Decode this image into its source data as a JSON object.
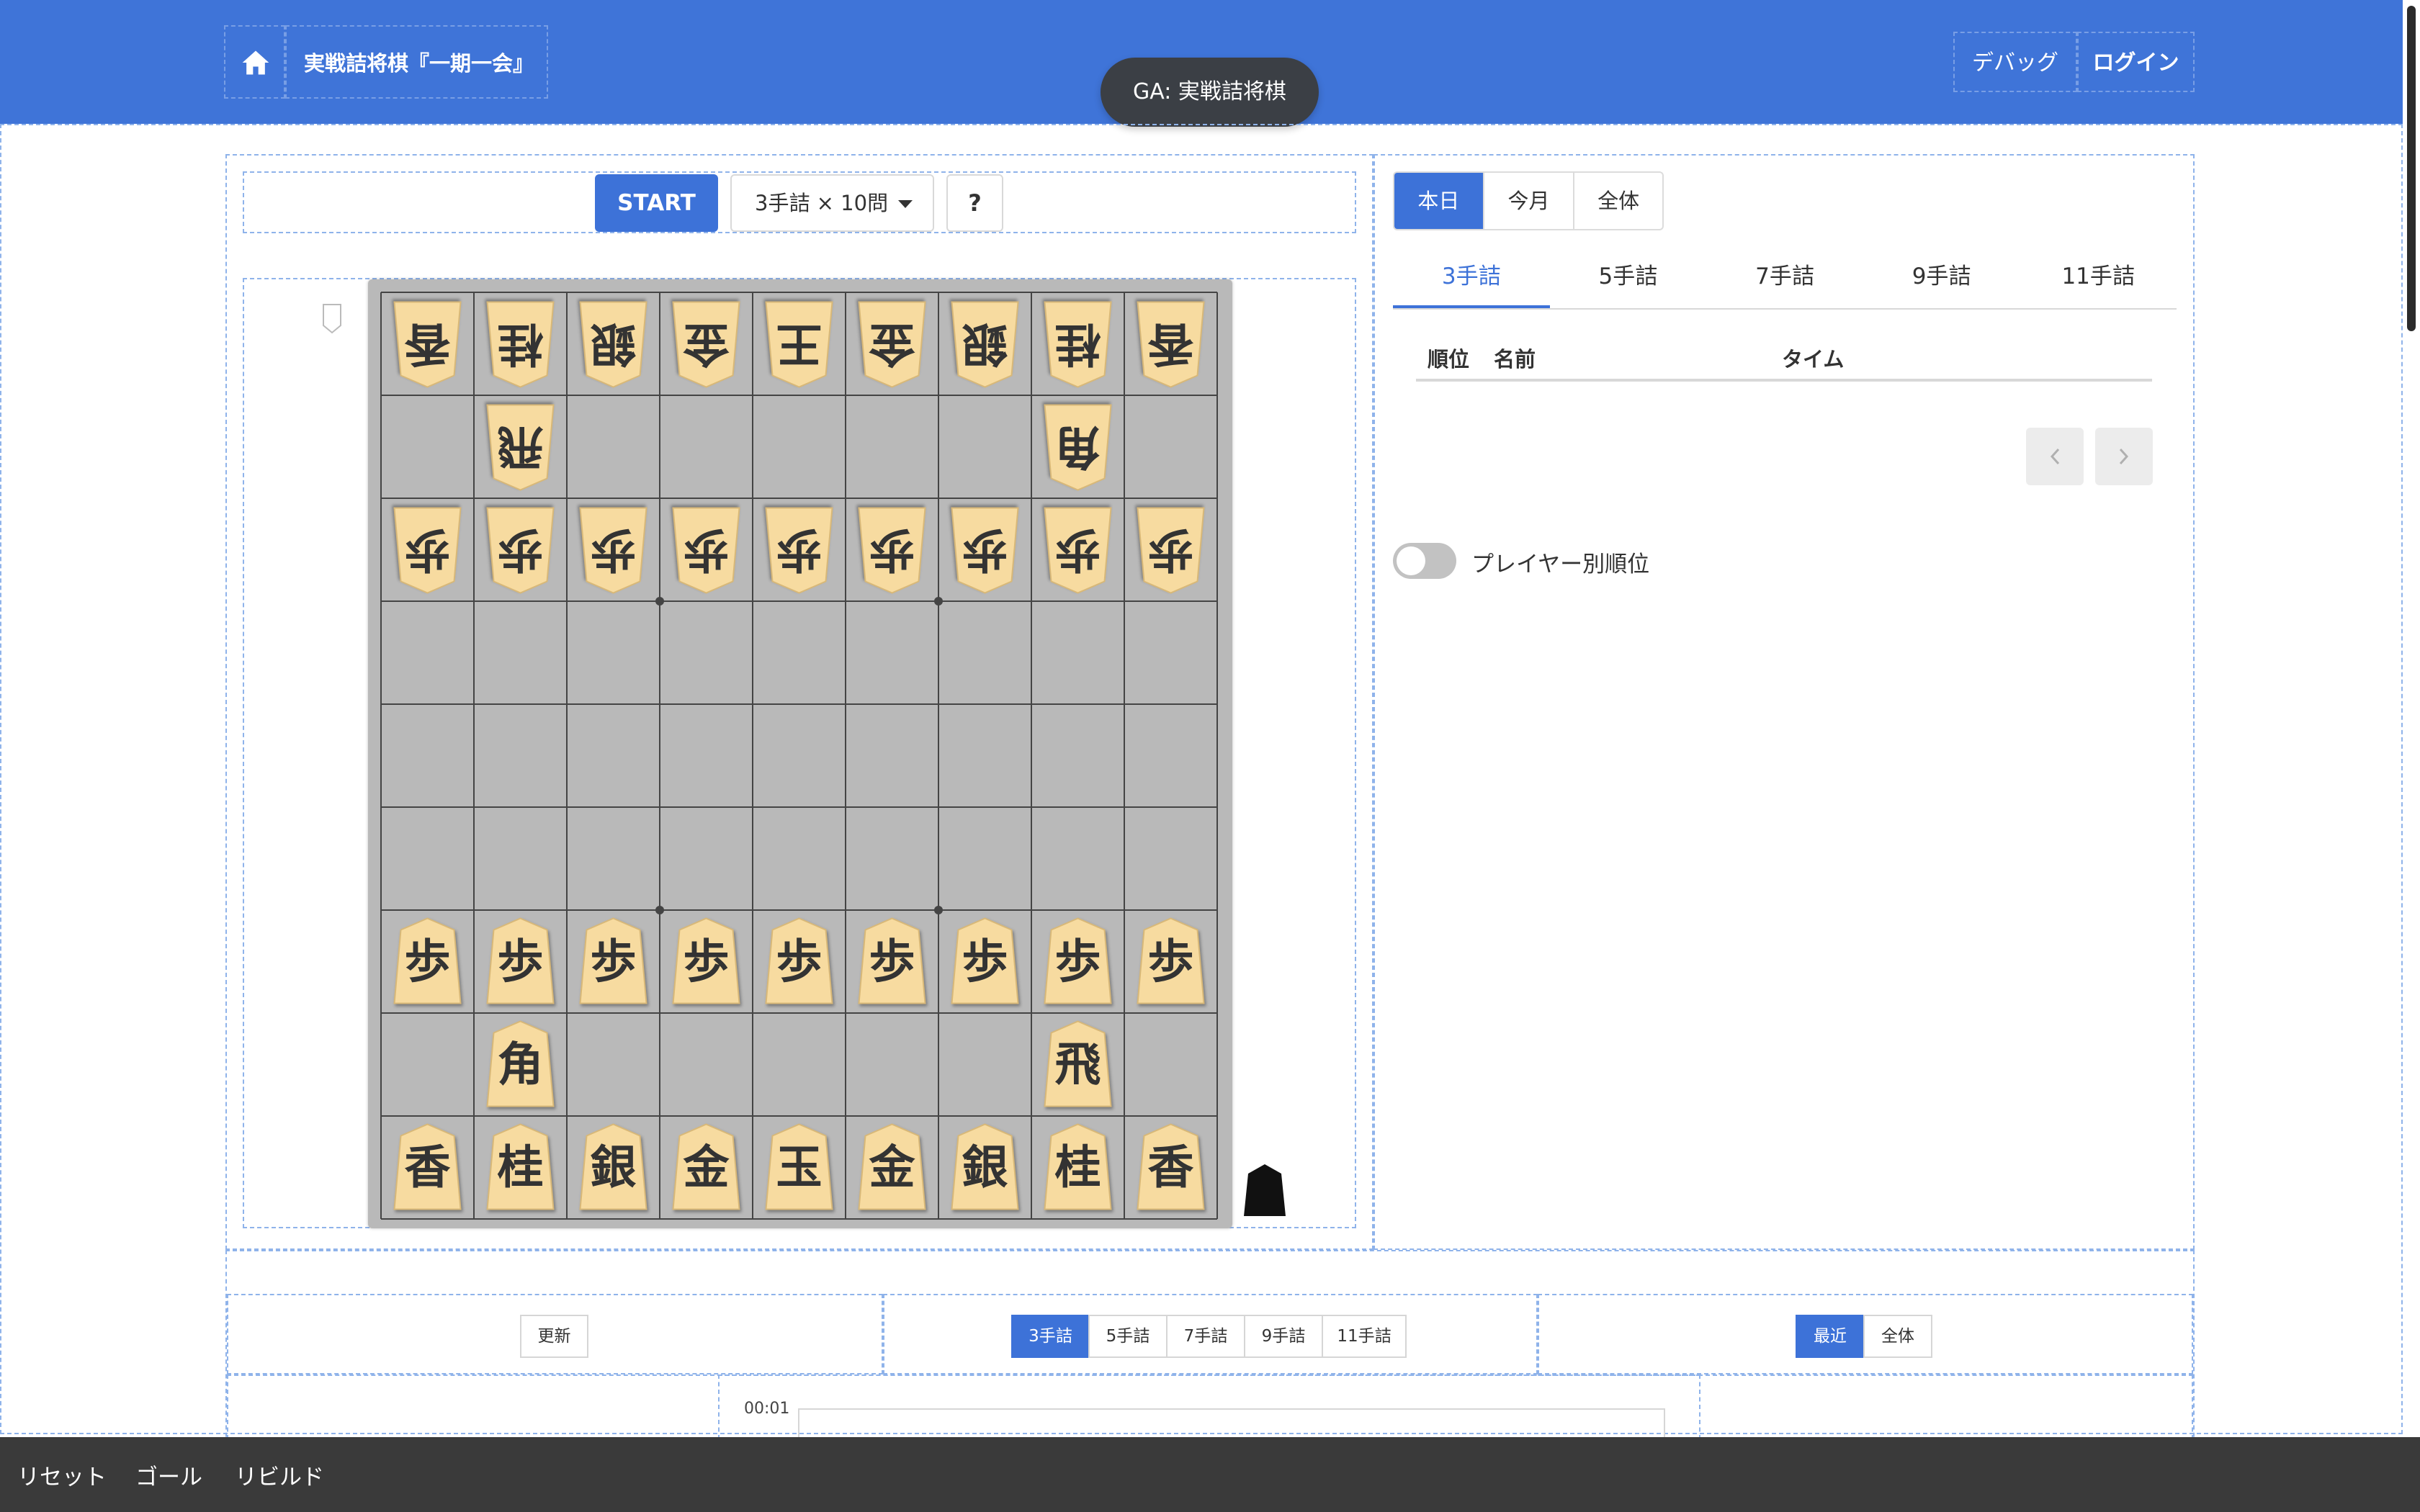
{
  "header": {
    "brand": "実戦詰将棋『一期一会』",
    "debug_label": "デバッグ",
    "login_label": "ログイン",
    "ga_toast": "GA: 実戦詰将棋"
  },
  "toolbar": {
    "start_label": "START",
    "problem_count": "3手詰 × 10問",
    "help_label": "?"
  },
  "board": {
    "files": 9,
    "ranks": 9,
    "colors": {
      "board": "#b9b9b9",
      "piece": "#f7dba0",
      "piece_text": "#333333",
      "accent": "#3d72d8"
    },
    "pieces": [
      {
        "rank": 1,
        "file": 9,
        "label": "香",
        "owner": "gote"
      },
      {
        "rank": 1,
        "file": 8,
        "label": "桂",
        "owner": "gote"
      },
      {
        "rank": 1,
        "file": 7,
        "label": "銀",
        "owner": "gote"
      },
      {
        "rank": 1,
        "file": 6,
        "label": "金",
        "owner": "gote"
      },
      {
        "rank": 1,
        "file": 5,
        "label": "王",
        "owner": "gote"
      },
      {
        "rank": 1,
        "file": 4,
        "label": "金",
        "owner": "gote"
      },
      {
        "rank": 1,
        "file": 3,
        "label": "銀",
        "owner": "gote"
      },
      {
        "rank": 1,
        "file": 2,
        "label": "桂",
        "owner": "gote"
      },
      {
        "rank": 1,
        "file": 1,
        "label": "香",
        "owner": "gote"
      },
      {
        "rank": 2,
        "file": 8,
        "label": "飛",
        "owner": "gote"
      },
      {
        "rank": 2,
        "file": 2,
        "label": "角",
        "owner": "gote"
      },
      {
        "rank": 3,
        "file": 9,
        "label": "歩",
        "owner": "gote"
      },
      {
        "rank": 3,
        "file": 8,
        "label": "歩",
        "owner": "gote"
      },
      {
        "rank": 3,
        "file": 7,
        "label": "歩",
        "owner": "gote"
      },
      {
        "rank": 3,
        "file": 6,
        "label": "歩",
        "owner": "gote"
      },
      {
        "rank": 3,
        "file": 5,
        "label": "歩",
        "owner": "gote"
      },
      {
        "rank": 3,
        "file": 4,
        "label": "歩",
        "owner": "gote"
      },
      {
        "rank": 3,
        "file": 3,
        "label": "歩",
        "owner": "gote"
      },
      {
        "rank": 3,
        "file": 2,
        "label": "歩",
        "owner": "gote"
      },
      {
        "rank": 3,
        "file": 1,
        "label": "歩",
        "owner": "gote"
      },
      {
        "rank": 7,
        "file": 9,
        "label": "歩",
        "owner": "sente"
      },
      {
        "rank": 7,
        "file": 8,
        "label": "歩",
        "owner": "sente"
      },
      {
        "rank": 7,
        "file": 7,
        "label": "歩",
        "owner": "sente"
      },
      {
        "rank": 7,
        "file": 6,
        "label": "歩",
        "owner": "sente"
      },
      {
        "rank": 7,
        "file": 5,
        "label": "歩",
        "owner": "sente"
      },
      {
        "rank": 7,
        "file": 4,
        "label": "歩",
        "owner": "sente"
      },
      {
        "rank": 7,
        "file": 3,
        "label": "歩",
        "owner": "sente"
      },
      {
        "rank": 7,
        "file": 2,
        "label": "歩",
        "owner": "sente"
      },
      {
        "rank": 7,
        "file": 1,
        "label": "歩",
        "owner": "sente"
      },
      {
        "rank": 8,
        "file": 8,
        "label": "角",
        "owner": "sente"
      },
      {
        "rank": 8,
        "file": 2,
        "label": "飛",
        "owner": "sente"
      },
      {
        "rank": 9,
        "file": 9,
        "label": "香",
        "owner": "sente"
      },
      {
        "rank": 9,
        "file": 8,
        "label": "桂",
        "owner": "sente"
      },
      {
        "rank": 9,
        "file": 7,
        "label": "銀",
        "owner": "sente"
      },
      {
        "rank": 9,
        "file": 6,
        "label": "金",
        "owner": "sente"
      },
      {
        "rank": 9,
        "file": 5,
        "label": "玉",
        "owner": "sente"
      },
      {
        "rank": 9,
        "file": 4,
        "label": "金",
        "owner": "sente"
      },
      {
        "rank": 9,
        "file": 3,
        "label": "銀",
        "owner": "sente"
      },
      {
        "rank": 9,
        "file": 2,
        "label": "桂",
        "owner": "sente"
      },
      {
        "rank": 9,
        "file": 1,
        "label": "香",
        "owner": "sente"
      }
    ]
  },
  "ranking": {
    "period_tabs": [
      {
        "label": "本日",
        "active": true
      },
      {
        "label": "今月",
        "active": false
      },
      {
        "label": "全体",
        "active": false
      }
    ],
    "level_tabs": [
      {
        "label": "3手詰",
        "active": true
      },
      {
        "label": "5手詰",
        "active": false
      },
      {
        "label": "7手詰",
        "active": false
      },
      {
        "label": "9手詰",
        "active": false
      },
      {
        "label": "11手詰",
        "active": false
      }
    ],
    "columns": {
      "rank": "順位",
      "name": "名前",
      "time": "タイム"
    },
    "rows": [],
    "toggle_label": "プレイヤー別順位",
    "toggle_on": false
  },
  "lower": {
    "refresh_label": "更新",
    "level_buttons": [
      {
        "label": "3手詰",
        "active": true
      },
      {
        "label": "5手詰",
        "active": false
      },
      {
        "label": "7手詰",
        "active": false
      },
      {
        "label": "9手詰",
        "active": false
      },
      {
        "label": "11手詰",
        "active": false
      }
    ],
    "range_buttons": [
      {
        "label": "最近",
        "active": true
      },
      {
        "label": "全体",
        "active": false
      }
    ],
    "chart_tick": "00:01"
  },
  "debug_bar": {
    "reset_label": "リセット",
    "goal_label": "ゴール",
    "rebuild_label": "リビルド"
  }
}
